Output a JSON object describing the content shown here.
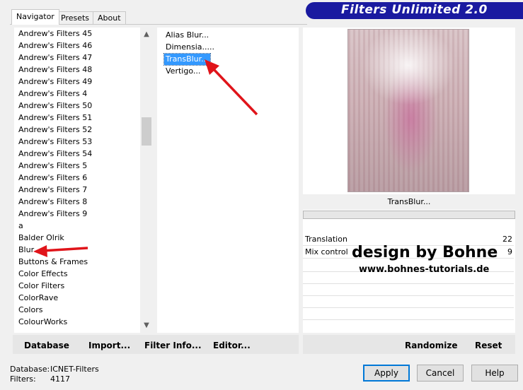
{
  "tabs": [
    {
      "label": "Navigator",
      "active": true
    },
    {
      "label": "Presets",
      "active": false
    },
    {
      "label": "About",
      "active": false
    }
  ],
  "banner": {
    "title": "Filters Unlimited 2.0",
    "color": "#1a1aa0"
  },
  "categories": [
    "Andrew's Filters 45",
    "Andrew's Filters 46",
    "Andrew's Filters 47",
    "Andrew's Filters 48",
    "Andrew's Filters 49",
    "Andrew's Filters 4",
    "Andrew's Filters 50",
    "Andrew's Filters 51",
    "Andrew's Filters 52",
    "Andrew's Filters 53",
    "Andrew's Filters 54",
    "Andrew's Filters 5",
    "Andrew's Filters 6",
    "Andrew's Filters 7",
    "Andrew's Filters 8",
    "Andrew's Filters 9",
    "a",
    "Balder Olrik",
    "Blur",
    "Buttons & Frames",
    "Color Effects",
    "Color Filters",
    "ColorRave",
    "Colors",
    "ColourWorks"
  ],
  "filters": [
    {
      "label": "Alias Blur...",
      "selected": false
    },
    {
      "label": "Dimensia.....",
      "selected": false
    },
    {
      "label": "TransBlur...",
      "selected": true
    },
    {
      "label": "Vertigo...",
      "selected": false
    }
  ],
  "preview": {
    "filter_name": "TransBlur..."
  },
  "params": [
    {
      "name": "Translation",
      "value": "22"
    },
    {
      "name": "Mix control",
      "value": "9"
    }
  ],
  "watermark": {
    "line1": "design by Bohne",
    "line2": "www.bohnes-tutorials.de"
  },
  "toolbar": {
    "database": "Database",
    "import": "Import...",
    "filter_info": "Filter Info...",
    "editor": "Editor...",
    "randomize": "Randomize",
    "reset": "Reset"
  },
  "status": {
    "database_label": "Database:",
    "database_value": "ICNET-Filters",
    "filters_label": "Filters:",
    "filters_value": "4117"
  },
  "buttons": {
    "apply": "Apply",
    "cancel": "Cancel",
    "help": "Help"
  },
  "accent_color": "#e0141a",
  "selection_color": "#3399ff"
}
